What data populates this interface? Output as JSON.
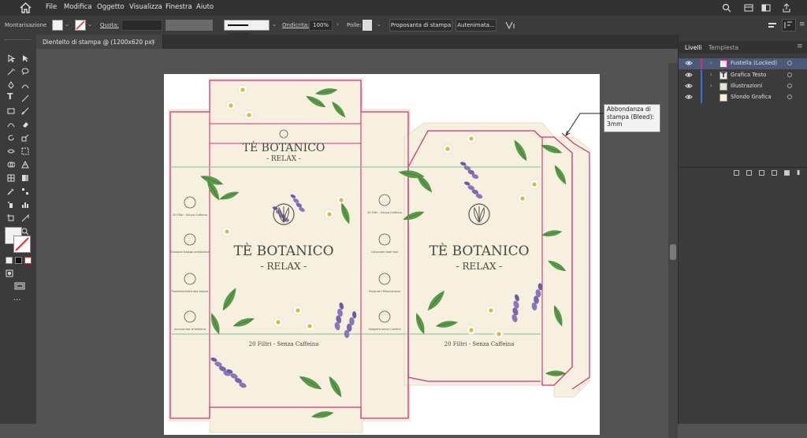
{
  "menubar": {
    "items": [
      "File",
      "Modifica",
      "Oggetto",
      "Visualizza",
      "Finestra",
      "Aiuto"
    ]
  },
  "controlbar": {
    "mode_label": "Montarisazione",
    "quota_label": "Quota:",
    "stroke_style": "Lergste",
    "ondicita_label": "Ondicrita:",
    "ondicita_value": "100%",
    "polle_label": "Polle:",
    "btn_print": "Proposanta di stampa",
    "btn_auto": "Autenimata..."
  },
  "document": {
    "tab_title": "Dientelto di stampa @ (1200x620 px)",
    "tab_close": "×"
  },
  "callout": {
    "line1": "Abbondanza di",
    "line2": "stampa (Bleed):",
    "line3": "3mm"
  },
  "package": {
    "brand": "TÈ BOTANICO",
    "subtitle": "- RELAX -",
    "footer": "20 Filtri - Senza Caffeina",
    "side_left_items": [
      "20 Filtri - Senza Caffeina",
      "Erosione tosage orealbtene",
      "Proelemenetto oox boiyzo",
      "Accorannto di fobtena"
    ],
    "side_right_items": [
      "20 Filtri - Senza Caffeina",
      "Cotoradre doel tael",
      "Fenarreni fillusnacione",
      "Seegisto senor Cevfica"
    ]
  },
  "layers_panel": {
    "tab_layers": "Livelli",
    "tab_template": "Templesta",
    "layers": [
      {
        "name": "Fustella (Locked)",
        "color": "#d0307a",
        "selected": true
      },
      {
        "name": "Grafica Testo",
        "color": "#3f6fd8",
        "selected": false
      },
      {
        "name": "Illustrazioni",
        "color": "#3f6fd8",
        "selected": false
      },
      {
        "name": "Sfondo Grafica",
        "color": "#3f6fd8",
        "selected": false
      }
    ]
  },
  "colors": {
    "accent_magenta": "#d0307a",
    "fold_green": "#7bc49a",
    "paper": "#f7f0df"
  }
}
